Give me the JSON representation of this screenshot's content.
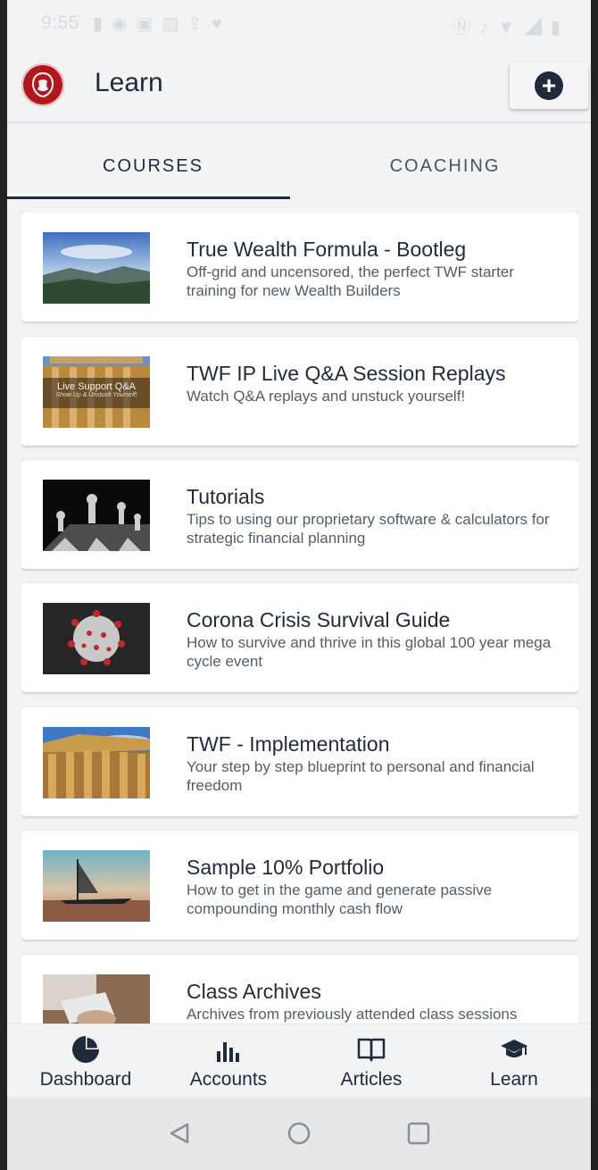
{
  "status_bar": {
    "time": "9:55"
  },
  "app_bar": {
    "title": "Learn"
  },
  "tabs": [
    {
      "label": "COURSES",
      "active": true
    },
    {
      "label": "COACHING",
      "active": false
    }
  ],
  "courses": [
    {
      "title": "True Wealth Formula - Bootleg",
      "description": "Off-grid and uncensored, the perfect TWF starter training for new Wealth Builders"
    },
    {
      "title": "TWF IP Live Q&A Session Replays",
      "description": "Watch Q&A replays and unstuck yourself!",
      "thumb_caption": "Live Support Q&A",
      "thumb_subcaption": "Show Up & Unstuck Yourself!"
    },
    {
      "title": "Tutorials",
      "description": "Tips to using our proprietary software & calculators for strategic financial planning"
    },
    {
      "title": "Corona Crisis Survival Guide",
      "description": "How to survive and thrive in this global 100 year mega cycle event"
    },
    {
      "title": "TWF - Implementation",
      "description": "Your step by step blueprint to personal and financial freedom"
    },
    {
      "title": "Sample 10% Portfolio",
      "description": "How to get in the game and generate passive compounding monthly cash flow"
    },
    {
      "title": "Class Archives",
      "description": "Archives from previously attended class sessions"
    }
  ],
  "bottom_nav": [
    {
      "label": "Dashboard",
      "icon": "pie-chart-icon"
    },
    {
      "label": "Accounts",
      "icon": "bar-chart-icon"
    },
    {
      "label": "Articles",
      "icon": "open-book-icon"
    },
    {
      "label": "Learn",
      "icon": "graduation-cap-icon"
    }
  ],
  "colors": {
    "primary": "#1f2a3a",
    "background": "#f2f3f5",
    "logo_red": "#b3161c"
  }
}
